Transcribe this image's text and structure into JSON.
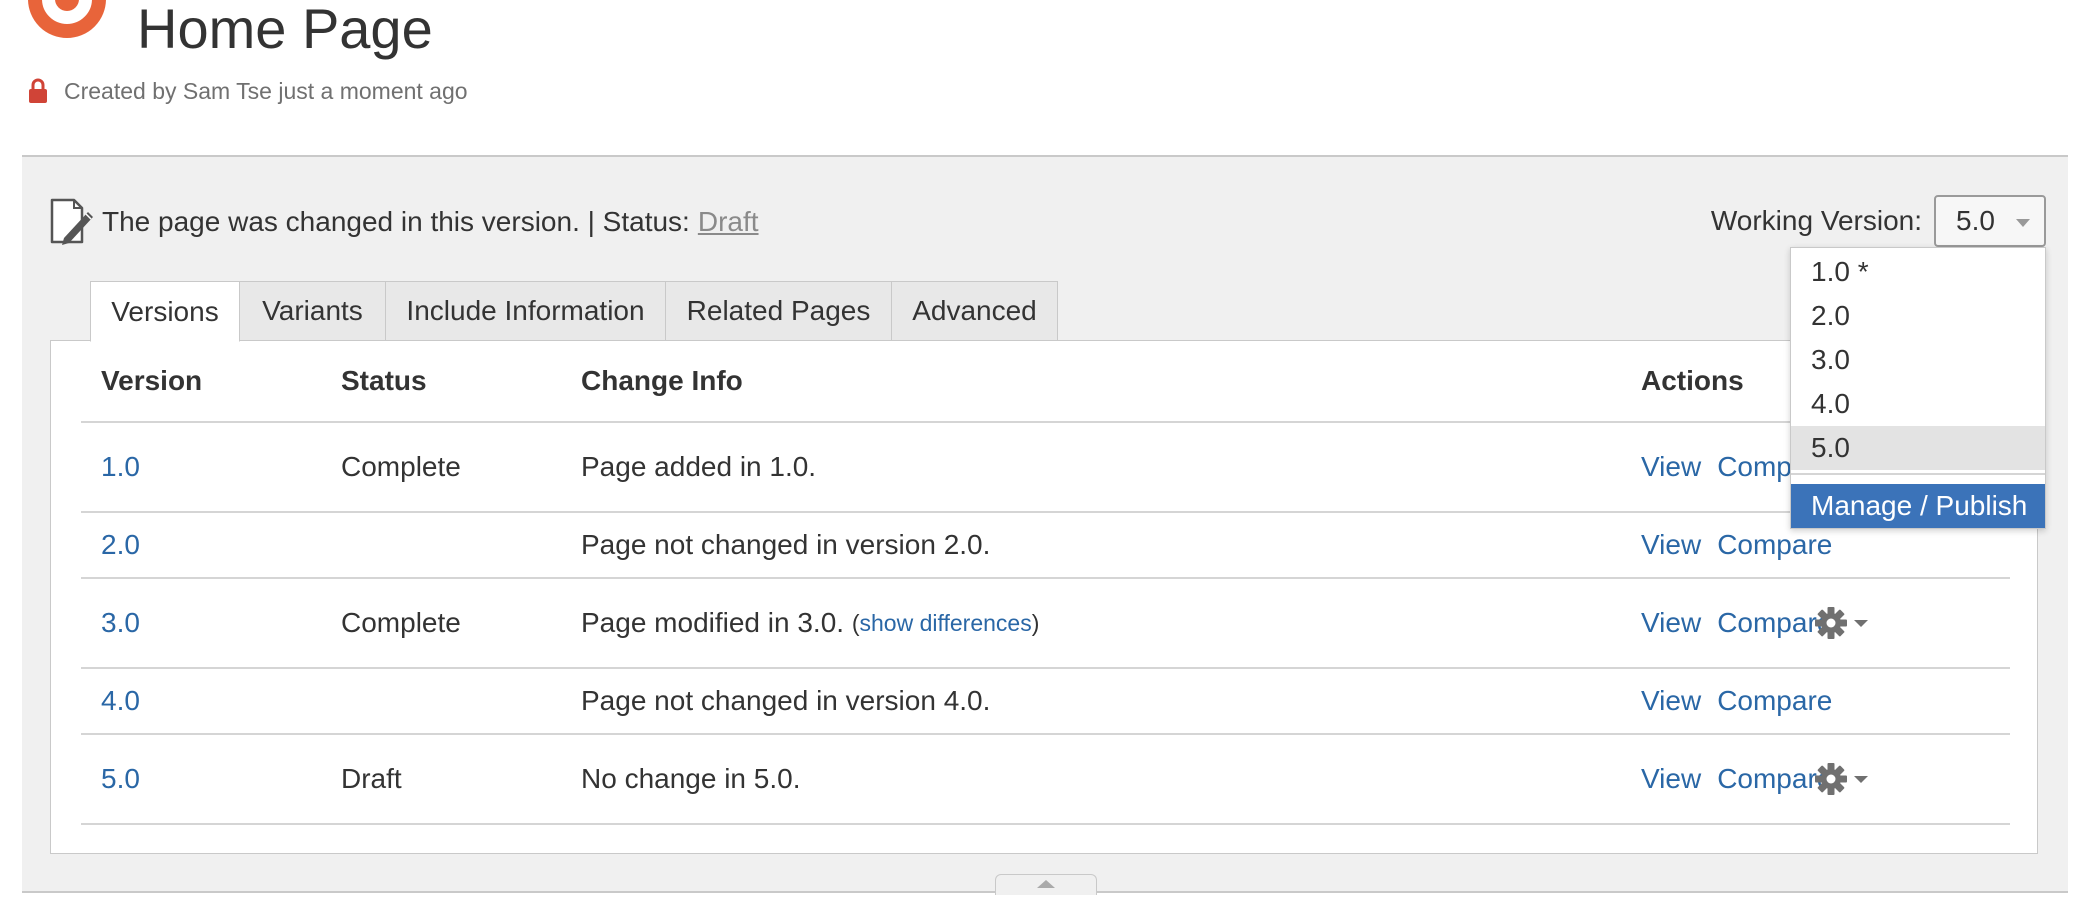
{
  "header": {
    "title": "Home Page",
    "byline": "Created by Sam Tse just a moment ago"
  },
  "status_bar": {
    "message": "The page was changed in this version. | Status:",
    "status_link": "Draft",
    "working_version_label": "Working Version:",
    "working_version_value": "5.0"
  },
  "tabs": [
    {
      "label": "Versions"
    },
    {
      "label": "Variants"
    },
    {
      "label": "Include Information"
    },
    {
      "label": "Related Pages"
    },
    {
      "label": "Advanced"
    }
  ],
  "table": {
    "columns": {
      "version": "Version",
      "status": "Status",
      "change_info": "Change Info",
      "actions": "Actions"
    },
    "action_labels": {
      "view": "View",
      "compare": "Compare"
    },
    "rows": [
      {
        "version": "1.0",
        "status": "Complete",
        "change": "Page added in 1.0."
      },
      {
        "version": "2.0",
        "status": "",
        "change": "Page not changed in version 2.0."
      },
      {
        "version": "3.0",
        "status": "Complete",
        "change": "Page modified in 3.0.",
        "diff_open": "(",
        "diff_link": "show differences",
        "diff_close": ")"
      },
      {
        "version": "4.0",
        "status": "",
        "change": "Page not changed in version 4.0."
      },
      {
        "version": "5.0",
        "status": "Draft",
        "change": "No change in 5.0."
      }
    ]
  },
  "version_dropdown": {
    "options": [
      "1.0 *",
      "2.0",
      "3.0",
      "4.0",
      "5.0"
    ],
    "selected": "5.0",
    "action": "Manage / Publish"
  },
  "colors": {
    "link": "#2a67a6",
    "brand_logo": "#e8643a",
    "lock": "#d04437",
    "dropdown_action": "#3b73b9"
  },
  "icons": {
    "logo": "brand-logo-icon",
    "lock": "lock-icon",
    "page_changed": "edit-document-icon",
    "row_menu": "gear-icon",
    "select_caret": "chevron-down-icon",
    "collapse": "collapse-up-icon"
  }
}
